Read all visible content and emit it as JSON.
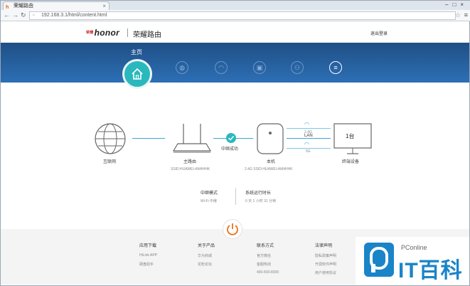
{
  "browser": {
    "tab_title": "荣耀路由",
    "url": "192.168.3.1/html/content.html"
  },
  "header": {
    "brand": "honor",
    "brand_prefix": "荣耀",
    "subtitle": "荣耀路由",
    "logout": "退出登录"
  },
  "banner": {
    "home_label": "主页"
  },
  "diagram": {
    "internet_label": "互联网",
    "main_router_label": "主路由",
    "main_router_ssid": "SSID:HUAWEI-AM4HHK",
    "relay_label": "中继成功",
    "this_device_label": "本机",
    "this_device_ssid": "2.4G SSID:HUAWEI-AM4HHK",
    "band_24g": "2.4G",
    "lan": "LAN",
    "band_5g": "5G",
    "device_count": "1台",
    "terminal_label": "终端设备"
  },
  "status": {
    "mode_label": "中继模式",
    "mode_value": "Wi-Fi 中继",
    "uptime_label": "系统运行时长",
    "uptime_value": "0 天 1 小时 31 分钟"
  },
  "footer": {
    "col1": {
      "title": "应用下载",
      "items": [
        "HiLink APP",
        "硬盘助手"
      ]
    },
    "col2": {
      "title": "关于产品",
      "items": [
        "华为商城",
        "花粉论坛"
      ]
    },
    "col3": {
      "title": "联系方式",
      "items": [
        "官方微信",
        "客服热线",
        "400-830-8300"
      ]
    },
    "col4": {
      "title": "法律声明",
      "items": [
        "隐私政策声明",
        "开源软件声明",
        "用户使用协议"
      ]
    }
  },
  "watermark": {
    "brand": "PConline",
    "name": "IT百科"
  },
  "colors": {
    "banner": "#2a66a8",
    "accent": "#2bb8bd",
    "power": "#e8731c"
  }
}
